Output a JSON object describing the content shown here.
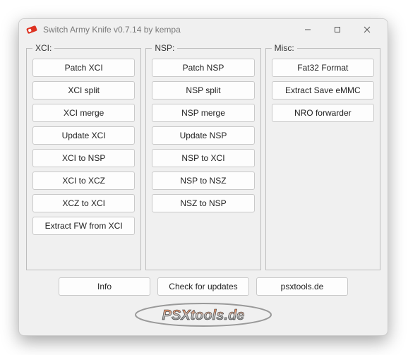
{
  "window": {
    "title": "Switch Army Knife v0.7.14 by kempa"
  },
  "groups": {
    "xci": {
      "legend": "XCI:",
      "buttons": [
        "Patch XCI",
        "XCI split",
        "XCI merge",
        "Update XCI",
        "XCI to NSP",
        "XCI to XCZ",
        "XCZ to XCI",
        "Extract FW from XCI"
      ]
    },
    "nsp": {
      "legend": "NSP:",
      "buttons": [
        "Patch NSP",
        "NSP split",
        "NSP merge",
        "Update NSP",
        "NSP to XCI",
        "NSP to NSZ",
        "NSZ to NSP"
      ]
    },
    "misc": {
      "legend": "Misc:",
      "buttons": [
        "Fat32 Format",
        "Extract Save eMMC",
        "NRO forwarder"
      ]
    }
  },
  "bottom": {
    "info": "Info",
    "check": "Check for updates",
    "site": "psxtools.de"
  },
  "logo_text": "PSXtools.de"
}
